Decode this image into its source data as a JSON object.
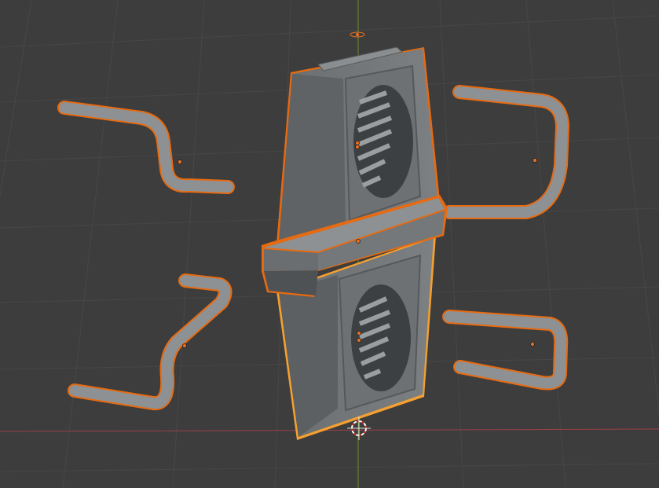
{
  "viewport": {
    "mode": "3d-viewport",
    "colors": {
      "background": "#3d3d3d",
      "grid": "#474747",
      "axis_x": "#9a4048",
      "axis_y": "#6b8a2f",
      "selection_outline": "#e86a10",
      "active_outline": "#f5a030",
      "mesh_light": "#8a8e90",
      "mesh_mid": "#6f7375",
      "mesh_dark": "#4c5052",
      "origin": "#e87020"
    },
    "icons": [
      "3d-cursor-icon",
      "light-gizmo-icon"
    ]
  }
}
